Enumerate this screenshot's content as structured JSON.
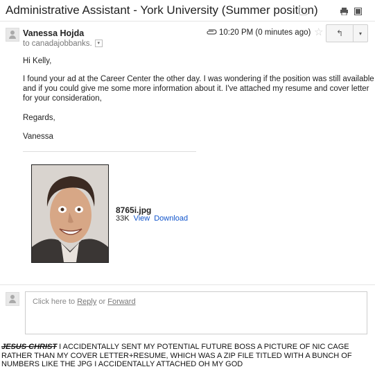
{
  "email": {
    "subject": "Administrative Assistant - York University (Summer position)",
    "sender": "Vanessa Hojda",
    "to": "to canadajobbanks.",
    "to_dropdown": "▾",
    "timestamp": "10:20 PM (0 minutes ago)",
    "star": "☆",
    "reply_icon": "↰",
    "more_icon": "▾",
    "greeting": "Hi Kelly,",
    "body_line1": "I found your ad at the Career Center the other day. I was wondering if the position was still available",
    "body_line2": "and if you could give me some more information about it. I've attached my resume and cover letter",
    "body_line3": "for your consideration,",
    "signoff": "Regards,",
    "signature": "Vanessa"
  },
  "attachment": {
    "filename": "8765i.jpg",
    "size": "33K",
    "view_label": "View",
    "download_label": "Download"
  },
  "reply": {
    "prefix": "Click here to ",
    "reply_label": "Reply",
    "middle": " or ",
    "forward_label": "Forward"
  },
  "caption": {
    "strike": "JESUS CHRIST",
    "text": " I ACCIDENTALLY SENT MY POTENTIAL FUTURE BOSS A PICTURE OF NIC CAGE RATHER THAN MY COVER LETTER+RESUME, WHICH WAS A ZIP FILE TITLED WITH A BUNCH OF NUMBERS LIKE THE JPG I ACCIDENTALLY ATTACHED OH MY GOD"
  },
  "icons": [
    "label-chip-icon",
    "print-icon",
    "new-window-icon",
    "avatar-icon",
    "paperclip-icon",
    "star-icon",
    "reply-icon",
    "chevron-down-icon"
  ],
  "colors": {
    "link": "#1155cc",
    "muted": "#777777"
  }
}
